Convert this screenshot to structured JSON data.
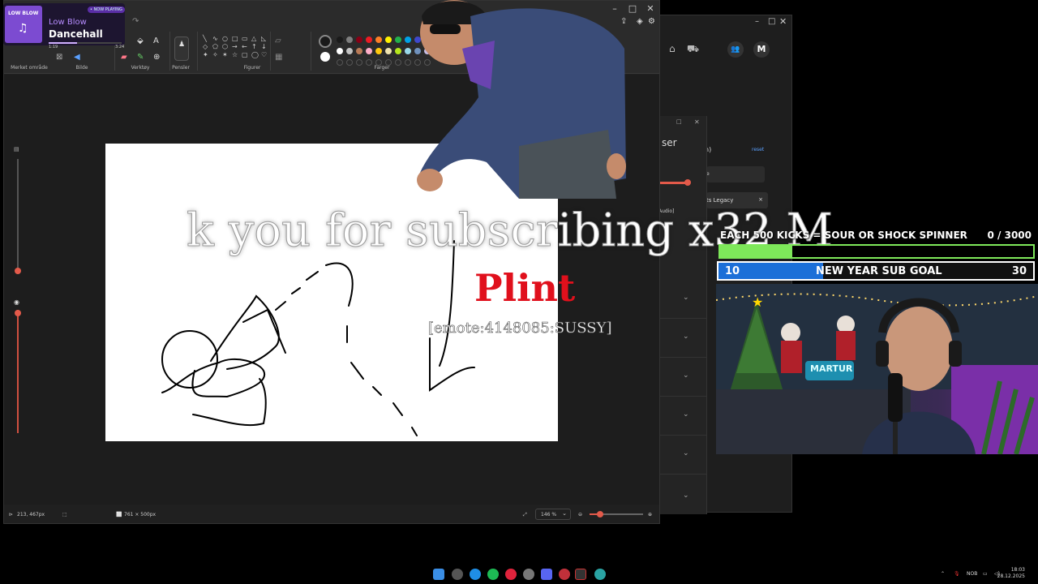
{
  "now_playing": {
    "badge": "• NOW PLAYING",
    "artist": "Low Blow",
    "title": "Dancehall",
    "cover_text": "LOW BLOW",
    "elapsed": "1:19",
    "duration": "3:24",
    "progress": 0.39
  },
  "paint": {
    "groups": {
      "selection": "Merket område",
      "image": "Bilde",
      "tools": "Verktøy",
      "brushes": "Pensler",
      "shapes": "Figurer",
      "colors": "Farger"
    },
    "status": {
      "cursor": "213, 467px",
      "canvas_size": "761 × 500px",
      "zoom": "146 %"
    },
    "zoom_slider": 0.2,
    "colors_row1": [
      "#1a1a1a",
      "#7f7f7f",
      "#880015",
      "#ed1c24",
      "#ff7f27",
      "#fff200",
      "#22b14c",
      "#00a2e8",
      "#3f48cc",
      "#a349a4"
    ],
    "colors_row2": [
      "#ffffff",
      "#c3c3c3",
      "#b97a57",
      "#ffaec9",
      "#ffc90e",
      "#efe4b0",
      "#b5e61d",
      "#99d9ea",
      "#7092be",
      "#c8bfe7"
    ]
  },
  "bg_window": {
    "title": "ser",
    "reset": "reset",
    "item": "ts Legacy",
    "audio": "Audio]",
    "paren": "n)",
    "tag": "e"
  },
  "alert": {
    "text": "k you for subscribing x32 M",
    "name": "Plint",
    "emote": "[emote:4148085:SUSSY]"
  },
  "kick_goal": {
    "label": "EACH 500 KICKS = SOUR OR SHOCK SPINNER",
    "value": "0  / 3000",
    "progress": 0.23
  },
  "sub_goal": {
    "label": "NEW YEAR SUB GOAL",
    "current": "10",
    "target": "30",
    "progress": 0.333
  },
  "webcam": {
    "sign": "MARTUR"
  },
  "taskbar": {
    "lang": "NOB",
    "time": "18:03",
    "date": "28.12.2025"
  }
}
